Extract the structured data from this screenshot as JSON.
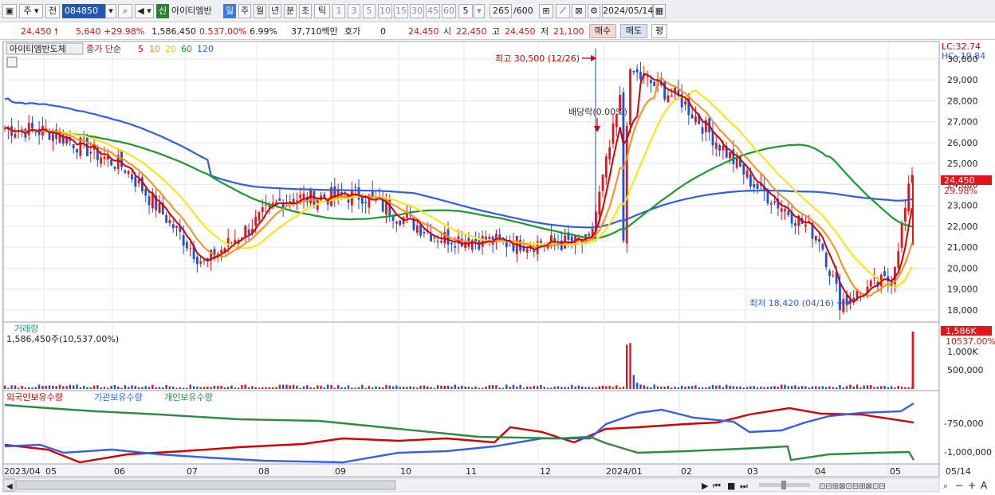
{
  "toolbar": {
    "market_code": "주",
    "prev_label": "전",
    "stock_code": "084850",
    "new_badge": "신",
    "stock_name": "아이티엠반",
    "periods": [
      "일",
      "주",
      "월",
      "년",
      "분",
      "초",
      "틱"
    ],
    "active_period": "일",
    "intervals": [
      "1",
      "3",
      "5",
      "10",
      "15",
      "30",
      "45",
      "60"
    ],
    "interval_value": "5",
    "count_value": "265",
    "count_total": "/600",
    "date": "2024/05/14"
  },
  "quote": {
    "price": "24,450",
    "change": "5,640",
    "change_pct": "+29.98%",
    "volume": "1,586,450",
    "volume_ratio": "0.537,00%",
    "turnover": "6.99%",
    "amount": "37,710백만",
    "hoga_label": "호가",
    "hoga_value": "0",
    "current": "24,450",
    "open_label": "시",
    "open": "22,450",
    "high_label": "고",
    "high": "24,450",
    "low_label": "저",
    "low": "21,100",
    "buy_label": "매수",
    "sell_label": "매도",
    "avg_label": "평"
  },
  "colors": {
    "up": "#e0161b",
    "down": "#1f4fd8",
    "ma5": "#d40000",
    "ma10": "#ff8c1a",
    "ma20": "#ffe41a",
    "ma60": "#1a9a2e",
    "ma120": "#2f5fe0",
    "foreign": "#d40000",
    "institution": "#3460e8",
    "individual": "#2e8b46"
  },
  "chart_data": [
    {
      "type": "candlestick",
      "panel": "price",
      "title": "아이티엠반도체",
      "legend_label": "종가 단순",
      "ma_periods": [
        "5",
        "10",
        "20",
        "60",
        "120"
      ],
      "lc_label": "LC:32.74",
      "hc_label": "HC:-19.84",
      "y_ticks": [
        "30,000",
        "29,000",
        "28,000",
        "27,000",
        "26,000",
        "25,000",
        "24,000",
        "23,000",
        "22,000",
        "21,000",
        "20,000",
        "19,000",
        "18,000"
      ],
      "ylim": [
        17500,
        30800
      ],
      "last_price_label": "24,450",
      "last_pct_label": "29.98%",
      "annotations": {
        "high": "최고 30,500 (12/26)",
        "dividend": "배당락(0.00%)",
        "low": "최저 18,420 (04/16)"
      },
      "key_points": [
        {
          "date": "2023/04",
          "close": 26700
        },
        {
          "date": "2023/05",
          "close": 26500
        },
        {
          "date": "2023/06",
          "close": 24800
        },
        {
          "date": "2023/07",
          "close": 20200
        },
        {
          "date": "2023/08",
          "close": 23300
        },
        {
          "date": "2023/09",
          "close": 23500
        },
        {
          "date": "2023/10",
          "close": 21500
        },
        {
          "date": "2023/11",
          "close": 21200
        },
        {
          "date": "2023/12",
          "close": 21200
        },
        {
          "date": "2023/12/26",
          "close": 29500
        },
        {
          "date": "2024/01",
          "close": 28000
        },
        {
          "date": "2024/02",
          "close": 24000
        },
        {
          "date": "2024/03",
          "close": 21500
        },
        {
          "date": "2024/04/16",
          "close": 18420
        },
        {
          "date": "2024/05",
          "close": 19500
        },
        {
          "date": "2024/05/14",
          "close": 24450
        }
      ]
    },
    {
      "type": "bar",
      "panel": "volume",
      "title": "거래량",
      "value_label": "1,586,450주(10,537.00%)",
      "y_ticks": [
        "1,000K",
        "500,000"
      ],
      "last_label": "1,586K",
      "last_pct_label": "10537.00%"
    },
    {
      "type": "line",
      "panel": "holdings",
      "series": [
        {
          "name": "외국인보유수량"
        },
        {
          "name": "기관보유수량"
        },
        {
          "name": "개인보유수량"
        }
      ],
      "y_ticks": [
        "-750,000",
        "-1,000,000"
      ]
    }
  ],
  "x_axis": {
    "labels": [
      "2023/04",
      "05",
      "06",
      "07",
      "08",
      "09",
      "10",
      "11",
      "12",
      "2024/01",
      "02",
      "03",
      "04",
      "05",
      "05/14"
    ]
  },
  "bottom_bar": {
    "play_buttons": [
      "▶",
      "⏮",
      "■",
      "⏭"
    ],
    "zoom_buttons": [
      "−",
      "+",
      "A"
    ]
  }
}
